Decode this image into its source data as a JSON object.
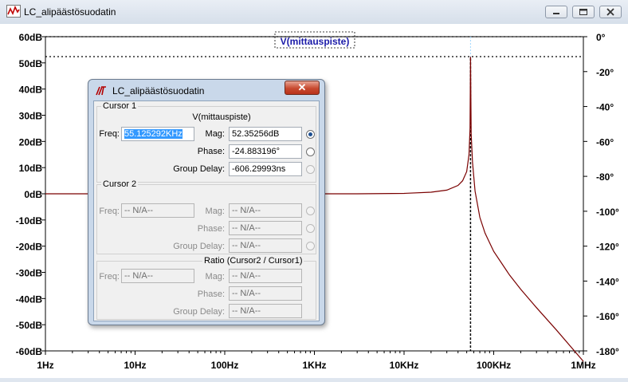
{
  "window": {
    "title": "LC_alipäästösuodatin"
  },
  "chart_data": {
    "type": "line",
    "trace_label": "V(mittauspiste)",
    "x_scale": "log",
    "xlim": [
      1,
      1000000
    ],
    "x_ticks": [
      "1Hz",
      "10Hz",
      "100Hz",
      "1KHz",
      "10KHz",
      "100KHz",
      "1MHz"
    ],
    "y_left_ticks": [
      "60dB",
      "50dB",
      "40dB",
      "30dB",
      "20dB",
      "10dB",
      "0dB",
      "-10dB",
      "-20dB",
      "-30dB",
      "-40dB",
      "-50dB",
      "-60dB"
    ],
    "y_left_lim": [
      -60,
      60
    ],
    "y_right_ticks": [
      "0°",
      "-20°",
      "-40°",
      "-60°",
      "-80°",
      "-100°",
      "-120°",
      "-140°",
      "-160°",
      "-180°"
    ],
    "y_right_lim": [
      -180,
      0
    ],
    "series": [
      {
        "x": [
          1,
          10,
          100,
          1000,
          3000,
          10000,
          20000,
          30000,
          40000,
          45000,
          50000,
          53000,
          54500,
          55125,
          56000,
          58000,
          62000,
          70000,
          80000,
          100000,
          150000,
          200000,
          300000,
          500000,
          1000000
        ],
        "values": [
          0,
          0,
          0,
          0,
          0.01,
          0.15,
          0.6,
          1.4,
          3.2,
          5,
          8.5,
          15,
          25,
          52.35,
          23,
          12,
          1,
          -9,
          -15,
          -22,
          -31,
          -36.5,
          -43.5,
          -52,
          -64
        ]
      }
    ],
    "cursor": {
      "freq": 55125,
      "level_db": 52.35
    },
    "colors": {
      "trace": "#7a0000",
      "cursor": "#000000",
      "grid": "#000000",
      "label": "#1a1aa8"
    }
  },
  "dialog": {
    "title": "LC_alipäästösuodatin",
    "close_glyph": "✕",
    "cursor1": {
      "group_label": "Cursor 1",
      "trace_name": "V(mittauspiste)",
      "freq_label": "Freq:",
      "freq_value": "55.125292KHz",
      "mag_label": "Mag:",
      "mag_value": "52.35256dB",
      "phase_label": "Phase:",
      "phase_value": "-24.883196°",
      "group_delay_label": "Group Delay:",
      "group_delay_value": "-606.29993ns"
    },
    "cursor2": {
      "group_label": "Cursor 2",
      "freq_label": "Freq:",
      "freq_value": "-- N/A--",
      "mag_label": "Mag:",
      "mag_value": "-- N/A--",
      "phase_label": "Phase:",
      "phase_value": "-- N/A--",
      "group_delay_label": "Group Delay:",
      "group_delay_value": "-- N/A--"
    },
    "ratio": {
      "group_label": "Ratio (Cursor2 / Cursor1)",
      "freq_label": "Freq:",
      "freq_value": "-- N/A--",
      "mag_label": "Mag:",
      "mag_value": "-- N/A--",
      "phase_label": "Phase:",
      "phase_value": "-- N/A--",
      "group_delay_label": "Group Delay:",
      "group_delay_value": "-- N/A--"
    }
  }
}
